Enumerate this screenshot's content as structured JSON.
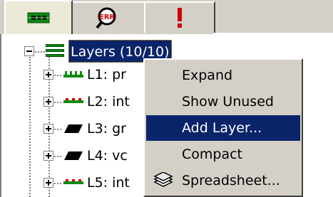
{
  "tabs": [
    {
      "name": "layers-tab",
      "icon": "board-chip-icon",
      "active": true
    },
    {
      "name": "error-search-tab",
      "icon": "error-magnifier-icon",
      "active": false,
      "icon_text": "ERR"
    },
    {
      "name": "warnings-tab",
      "icon": "exclamation-icon",
      "active": false
    }
  ],
  "tree": {
    "root": {
      "label": "Layers (10/10)",
      "icon": "layer-stack-icon"
    },
    "items": [
      {
        "label": "L1: pr",
        "icon": "signal-layer-icon"
      },
      {
        "label": "L2: int",
        "icon": "signal-layer-icon"
      },
      {
        "label": "L3: gr",
        "icon": "plane-layer-icon"
      },
      {
        "label": "L4: vc",
        "icon": "plane-layer-icon"
      },
      {
        "label": "L5: int",
        "icon": "signal-layer-icon"
      }
    ]
  },
  "context_menu": {
    "items": [
      {
        "label": "Expand",
        "highlighted": false
      },
      {
        "label": "Show Unused",
        "highlighted": false
      },
      {
        "label": "Add Layer...",
        "highlighted": true
      },
      {
        "label": "Compact",
        "highlighted": false
      },
      {
        "label": "Spreadsheet...",
        "highlighted": false,
        "icon": "spreadsheet-stack-icon"
      }
    ]
  },
  "colors": {
    "selection": "#0a246a",
    "layer_green": "#0b8a12",
    "error_red": "#cc0000",
    "chrome": "#d4d0c8"
  }
}
